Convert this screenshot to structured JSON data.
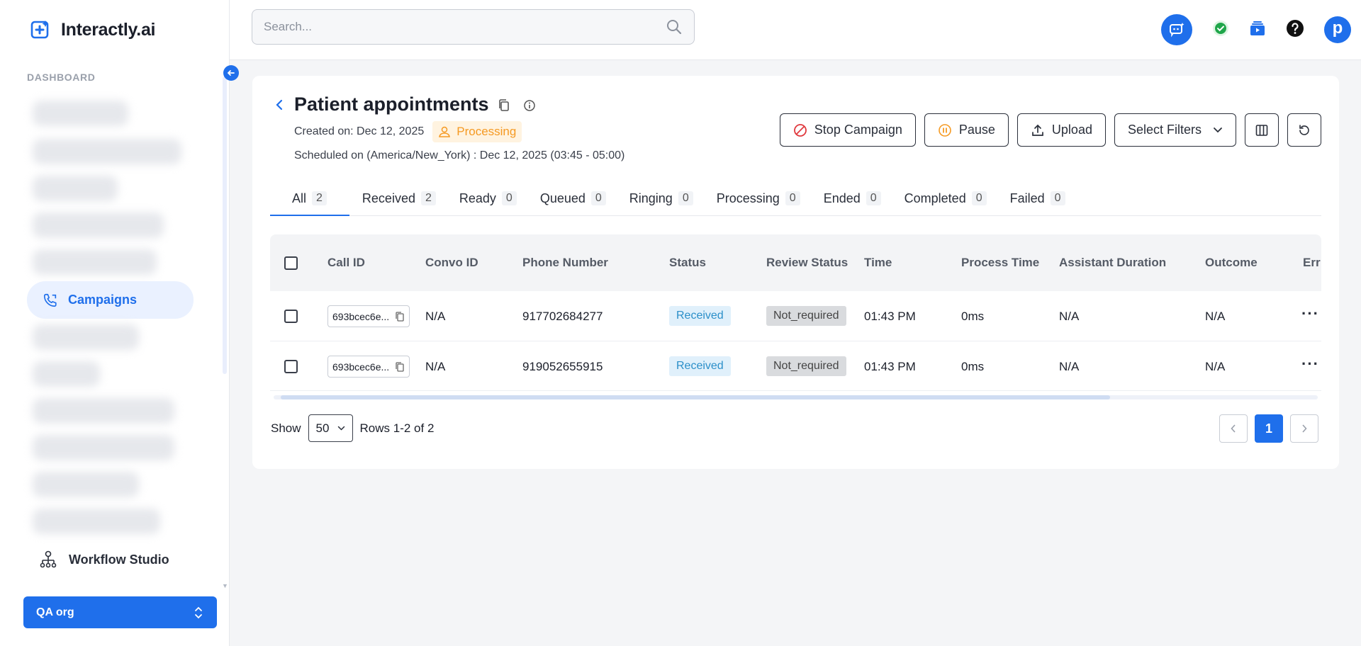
{
  "app": {
    "name": "Interactly.ai"
  },
  "sidebar": {
    "section_label": "DASHBOARD",
    "active_item": "Campaigns",
    "workflow_item": "Workflow Studio",
    "org": "QA org"
  },
  "search": {
    "placeholder": "Search..."
  },
  "page": {
    "title": "Patient appointments",
    "created_on": "Created on: Dec 12, 2025",
    "status_badge": "Processing",
    "scheduled": "Scheduled on (America/New_York) : Dec 12, 2025 (03:45 - 05:00)"
  },
  "actions": {
    "stop": "Stop Campaign",
    "pause": "Pause",
    "upload": "Upload",
    "filters": "Select Filters"
  },
  "tabs": [
    {
      "label": "All",
      "count": "2"
    },
    {
      "label": "Received",
      "count": "2"
    },
    {
      "label": "Ready",
      "count": "0"
    },
    {
      "label": "Queued",
      "count": "0"
    },
    {
      "label": "Ringing",
      "count": "0"
    },
    {
      "label": "Processing",
      "count": "0"
    },
    {
      "label": "Ended",
      "count": "0"
    },
    {
      "label": "Completed",
      "count": "0"
    },
    {
      "label": "Failed",
      "count": "0"
    }
  ],
  "table": {
    "columns": [
      "Call ID",
      "Convo ID",
      "Phone Number",
      "Status",
      "Review Status",
      "Time",
      "Process Time",
      "Assistant Duration",
      "Outcome",
      "Err"
    ],
    "rows": [
      {
        "call_id": "693bcec6e...",
        "convo_id": "N/A",
        "phone": "917702684277",
        "status": "Received",
        "review": "Not_required",
        "time": "01:43 PM",
        "process_time": "0ms",
        "assistant_duration": "N/A",
        "outcome": "N/A"
      },
      {
        "call_id": "693bcec6e...",
        "convo_id": "N/A",
        "phone": "919052655915",
        "status": "Received",
        "review": "Not_required",
        "time": "01:43 PM",
        "process_time": "0ms",
        "assistant_duration": "N/A",
        "outcome": "N/A"
      }
    ]
  },
  "footer": {
    "show_label": "Show",
    "page_size": "50",
    "rows_text": "Rows 1-2 of 2",
    "current_page": "1"
  },
  "colors": {
    "accent": "#1f6feb",
    "processing": "#f59a23",
    "received": "#2b8fc9"
  }
}
